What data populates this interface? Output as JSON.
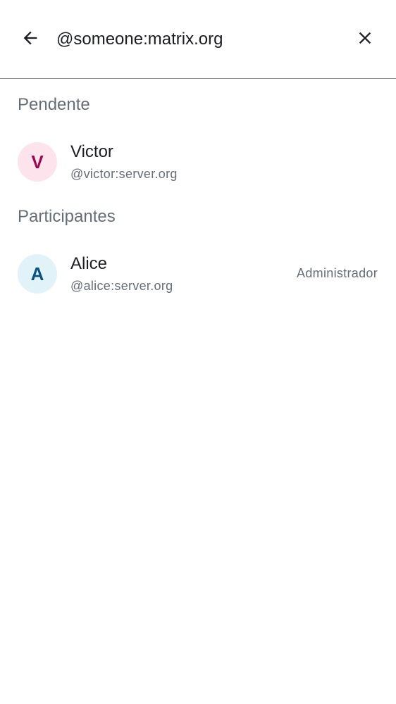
{
  "search": {
    "value": "@someone:matrix.org",
    "back_icon": "arrow-back-icon",
    "clear_icon": "close-icon"
  },
  "sections": {
    "pending": {
      "title": "Pendente",
      "members": [
        {
          "initial": "V",
          "name": "Victor",
          "user_id": "@victor:server.org",
          "avatar_bg": "#fde4ec",
          "avatar_fg": "#9b0a4e"
        }
      ]
    },
    "participants": {
      "title": "Participantes",
      "members": [
        {
          "initial": "A",
          "name": "Alice",
          "user_id": "@alice:server.org",
          "role": "Administrador",
          "avatar_bg": "#e1f3f9",
          "avatar_fg": "#0a5480"
        }
      ]
    }
  }
}
